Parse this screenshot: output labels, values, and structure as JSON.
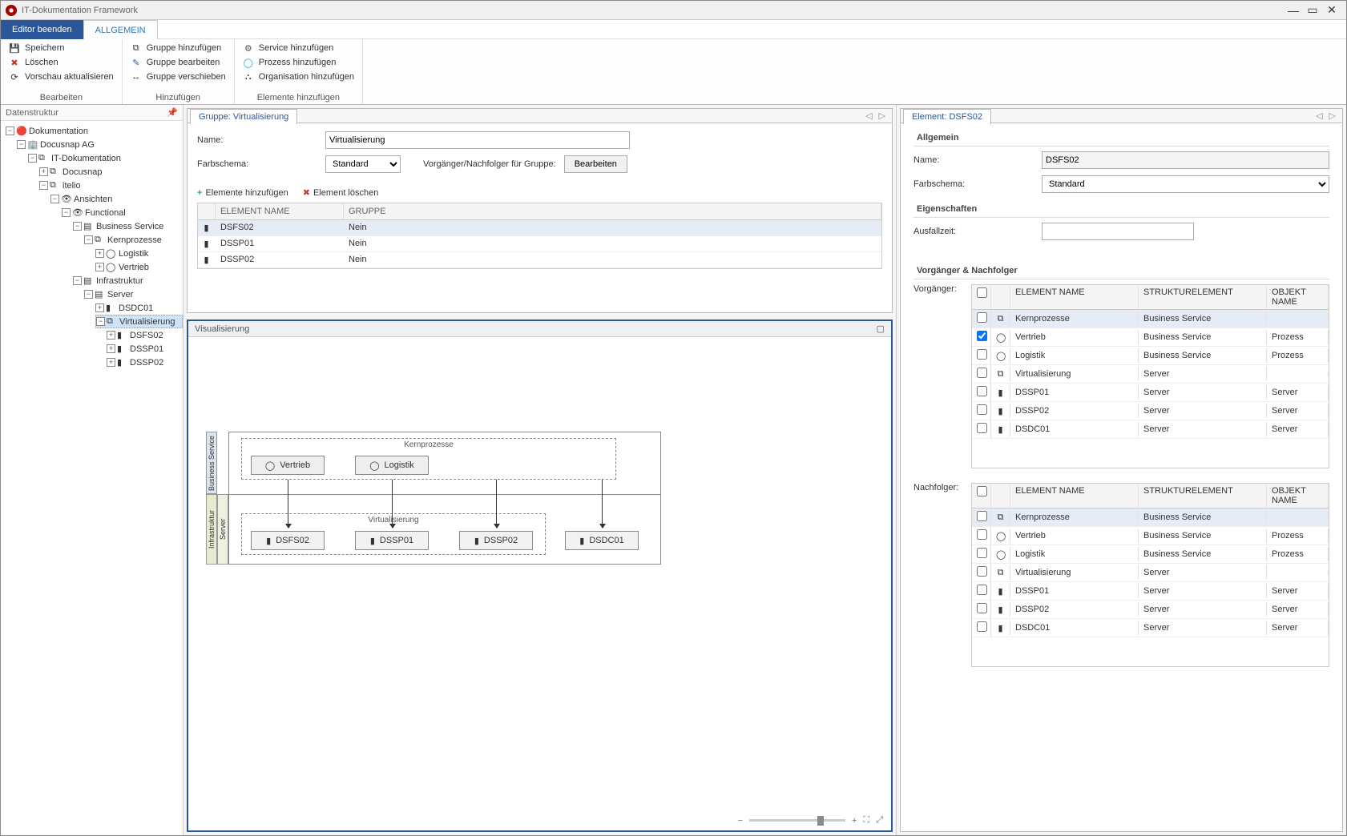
{
  "window": {
    "title": "IT-Dokumentation Framework"
  },
  "ribbon": {
    "primary_tab": "Editor beenden",
    "active_tab": "ALLGEMEIN",
    "groups": {
      "edit": {
        "caption": "Bearbeiten",
        "save": "Speichern",
        "delete": "Löschen",
        "refresh": "Vorschau aktualisieren"
      },
      "add": {
        "caption": "Hinzufügen",
        "add_group": "Gruppe hinzufügen",
        "edit_group": "Gruppe bearbeiten",
        "move_group": "Gruppe verschieben"
      },
      "elements": {
        "caption": "Elemente hinzufügen",
        "add_service": "Service hinzufügen",
        "add_process": "Prozess hinzufügen",
        "add_org": "Organisation hinzufügen"
      }
    }
  },
  "sidebar": {
    "title": "Datenstruktur",
    "tree": {
      "root": "Dokumentation",
      "company": "Docusnap AG",
      "itdoc": "IT-Dokumentation",
      "docusnap": "Docusnap",
      "itelio": "itelio",
      "ansichten": "Ansichten",
      "functional": "Functional",
      "business_service": "Business Service",
      "kernprozesse": "Kernprozesse",
      "logistik": "Logistik",
      "vertrieb": "Vertrieb",
      "infrastruktur": "Infrastruktur",
      "server": "Server",
      "dsdc01": "DSDC01",
      "virtualisierung": "Virtualisierung",
      "dsfs02": "DSFS02",
      "dssp01": "DSSP01",
      "dssp02": "DSSP02"
    }
  },
  "group_panel": {
    "tab": "Gruppe: Virtualisierung",
    "labels": {
      "name": "Name:",
      "color": "Farbschema:",
      "pred_succ": "Vorgänger/Nachfolger für Gruppe:"
    },
    "values": {
      "name": "Virtualisierung",
      "color": "Standard"
    },
    "buttons": {
      "edit": "Bearbeiten",
      "add_elem": "Elemente hinzufügen",
      "del_elem": "Element löschen"
    },
    "columns": {
      "name": "ELEMENT NAME",
      "group": "GRUPPE"
    },
    "rows": [
      {
        "name": "DSFS02",
        "group": "Nein"
      },
      {
        "name": "DSSP01",
        "group": "Nein"
      },
      {
        "name": "DSSP02",
        "group": "Nein"
      }
    ]
  },
  "visualization": {
    "title": "Visualisierung",
    "lanes": {
      "business": "Business Service",
      "infra": "Infrastruktur",
      "server": "Server"
    },
    "top_group": "Kernprozesse",
    "bottom_group": "Virtualisierung",
    "nodes": {
      "vertrieb": "Vertrieb",
      "logistik": "Logistik",
      "dsfs02": "DSFS02",
      "dssp01": "DSSP01",
      "dssp02": "DSSP02",
      "dsdc01": "DSDC01"
    }
  },
  "element_panel": {
    "tab": "Element: DSFS02",
    "sections": {
      "general": "Allgemein",
      "props": "Eigenschaften",
      "pred_succ": "Vorgänger & Nachfolger"
    },
    "labels": {
      "name": "Name:",
      "color": "Farbschema:",
      "downtime": "Ausfallzeit:",
      "pred": "Vorgänger:",
      "succ": "Nachfolger:"
    },
    "values": {
      "name": "DSFS02",
      "color": "Standard",
      "downtime": ""
    },
    "columns": {
      "name": "ELEMENT NAME",
      "struct": "STRUKTURELEMENT",
      "obj": "OBJEKT NAME"
    },
    "pred_rows": [
      {
        "checked": false,
        "name": "Kernprozesse",
        "struct": "Business Service",
        "obj": "",
        "sel": true
      },
      {
        "checked": true,
        "name": "Vertrieb",
        "struct": "Business Service",
        "obj": "Prozess"
      },
      {
        "checked": false,
        "name": "Logistik",
        "struct": "Business Service",
        "obj": "Prozess"
      },
      {
        "checked": false,
        "name": "Virtualisierung",
        "struct": "Server",
        "obj": ""
      },
      {
        "checked": false,
        "name": "DSSP01",
        "struct": "Server",
        "obj": "Server"
      },
      {
        "checked": false,
        "name": "DSSP02",
        "struct": "Server",
        "obj": "Server"
      },
      {
        "checked": false,
        "name": "DSDC01",
        "struct": "Server",
        "obj": "Server"
      }
    ],
    "succ_rows": [
      {
        "checked": false,
        "name": "Kernprozesse",
        "struct": "Business Service",
        "obj": "",
        "sel": true
      },
      {
        "checked": false,
        "name": "Vertrieb",
        "struct": "Business Service",
        "obj": "Prozess"
      },
      {
        "checked": false,
        "name": "Logistik",
        "struct": "Business Service",
        "obj": "Prozess"
      },
      {
        "checked": false,
        "name": "Virtualisierung",
        "struct": "Server",
        "obj": ""
      },
      {
        "checked": false,
        "name": "DSSP01",
        "struct": "Server",
        "obj": "Server"
      },
      {
        "checked": false,
        "name": "DSSP02",
        "struct": "Server",
        "obj": "Server"
      },
      {
        "checked": false,
        "name": "DSDC01",
        "struct": "Server",
        "obj": "Server"
      }
    ]
  }
}
